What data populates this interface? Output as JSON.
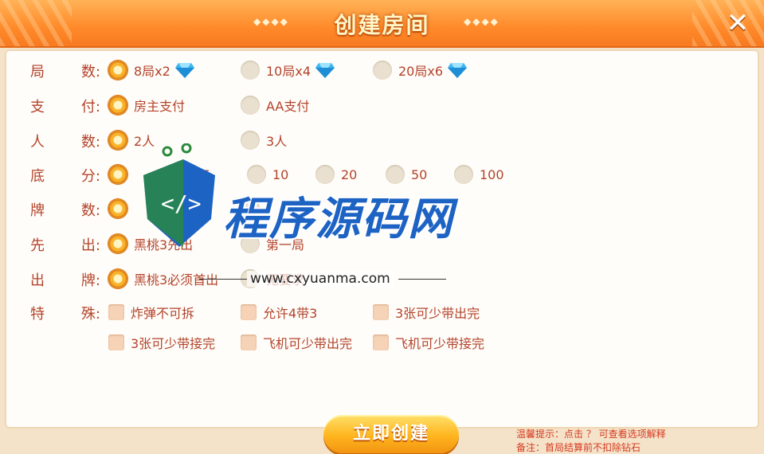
{
  "header": {
    "title": "创建房间",
    "deco_left": "◆◆◆◆",
    "deco_right": "◆◆◆◆",
    "close_glyph": "✕"
  },
  "rows": [
    {
      "label": [
        "局",
        "数:"
      ],
      "type": "radio",
      "options": [
        {
          "text": "8局x2",
          "selected": true,
          "gem": true
        },
        {
          "text": "10局x4",
          "selected": false,
          "gem": true
        },
        {
          "text": "20局x6",
          "selected": false,
          "gem": true
        }
      ]
    },
    {
      "label": [
        "支",
        "付:"
      ],
      "type": "radio",
      "options": [
        {
          "text": "房主支付",
          "selected": true
        },
        {
          "text": "AA支付",
          "selected": false
        }
      ]
    },
    {
      "label": [
        "人",
        "数:"
      ],
      "type": "radio",
      "options": [
        {
          "text": "2人",
          "selected": true
        },
        {
          "text": "3人",
          "selected": false
        }
      ]
    },
    {
      "label": [
        "底",
        "分:"
      ],
      "type": "radio",
      "options": [
        {
          "text": "",
          "selected": true
        },
        {
          "text": "5",
          "selected": false
        },
        {
          "text": "10",
          "selected": false
        },
        {
          "text": "20",
          "selected": false
        },
        {
          "text": "50",
          "selected": false
        },
        {
          "text": "100",
          "selected": false
        }
      ]
    },
    {
      "label": [
        "牌",
        "数:"
      ],
      "type": "radio",
      "options": [
        {
          "text": "",
          "selected": true
        },
        {
          "text": "",
          "selected": false
        }
      ]
    },
    {
      "label": [
        "先",
        "出:"
      ],
      "type": "radio",
      "options": [
        {
          "text": "黑桃3先出",
          "selected": true
        },
        {
          "text": "第一局",
          "selected": false
        }
      ]
    },
    {
      "label": [
        "出",
        "牌:"
      ],
      "type": "radio",
      "options": [
        {
          "text": "黑桃3必须首出",
          "selected": true
        },
        {
          "text": "无要求",
          "selected": false
        }
      ]
    },
    {
      "label": [
        "特",
        "殊:"
      ],
      "type": "check",
      "options": [
        {
          "text": "炸弹不可拆"
        },
        {
          "text": "允许4带3"
        },
        {
          "text": "3张可少带出完"
        }
      ]
    },
    {
      "label": [
        "",
        ""
      ],
      "type": "check",
      "options": [
        {
          "text": "3张可少带接完"
        },
        {
          "text": "飞机可少带出完"
        },
        {
          "text": "飞机可少带接完"
        }
      ]
    }
  ],
  "create_button": "立即创建",
  "tips": {
    "line1": "温馨提示：点击 ？ 可查看选项解释",
    "line2": "备注：首局结算前不扣除钻石"
  },
  "watermark": {
    "text": "程序源码网",
    "url": "www.cxyuanma.com"
  },
  "colors": {
    "accent": "#ff8a2a",
    "text": "#b3432b",
    "tip": "#d63a1f",
    "watermark": "#1d63c4"
  }
}
